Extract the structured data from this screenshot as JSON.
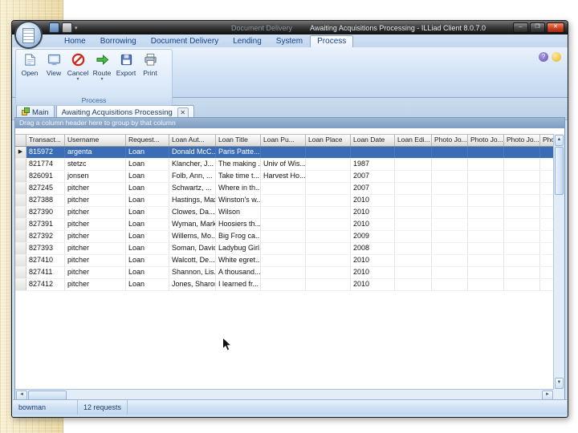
{
  "window": {
    "title_prefix": "Document Delivery",
    "title": "Awaiting Acquisitions Processing - ILLiad Client 8.0.7.0",
    "controls": {
      "minimize": "–",
      "maximize": "❐",
      "close": "✕"
    }
  },
  "quick_access": {
    "dropdown_glyph": "▾"
  },
  "ribbon": {
    "help_glyph": "?",
    "tabs": [
      {
        "label": "Home"
      },
      {
        "label": "Borrowing"
      },
      {
        "label": "Document Delivery"
      },
      {
        "label": "Lending"
      },
      {
        "label": "System"
      },
      {
        "label": "Process",
        "active": true
      }
    ],
    "group": {
      "label": "Process",
      "buttons": [
        {
          "label": "Open",
          "icon": "open-icon"
        },
        {
          "label": "View",
          "icon": "view-icon"
        },
        {
          "label": "Cancel",
          "icon": "cancel-icon",
          "menu": true
        },
        {
          "label": "Route",
          "icon": "route-icon",
          "menu": true
        },
        {
          "label": "Export",
          "icon": "export-icon"
        },
        {
          "label": "Print",
          "icon": "print-icon"
        }
      ]
    }
  },
  "doc_tabs": [
    {
      "label": "Main",
      "icon": "main-tab-icon"
    },
    {
      "label": "Awaiting Acquisitions Processing",
      "active": true,
      "closable": true,
      "close_glyph": "✕"
    }
  ],
  "grid": {
    "group_hint": "Drag a column header here to group by that column",
    "columns": [
      "Transact...",
      "Username",
      "Request...",
      "Loan Aut...",
      "Loan Title",
      "Loan Pu...",
      "Loan Place",
      "Loan Date",
      "Loan Edi...",
      "Photo Jo...",
      "Photo Jo...",
      "Photo Jo...",
      "Photo Jo..."
    ],
    "rows": [
      {
        "selected": true,
        "cells": [
          "815972",
          "argenta",
          "Loan",
          "Donald McC...",
          "Paris Patte...",
          "",
          "",
          "",
          "",
          "",
          "",
          "",
          ""
        ]
      },
      {
        "selected": false,
        "cells": [
          "821774",
          "stetzc",
          "Loan",
          "Klancher, J...",
          "The making ...",
          "Univ of Wis...",
          "",
          "1987",
          "",
          "",
          "",
          "",
          ""
        ]
      },
      {
        "selected": false,
        "cells": [
          "826091",
          "jonsen",
          "Loan",
          "Folb, Ann, ...",
          "Take time t...",
          "Harvest Ho...",
          "",
          "2007",
          "",
          "",
          "",
          "",
          ""
        ]
      },
      {
        "selected": false,
        "cells": [
          "827245",
          "pitcher",
          "Loan",
          "Schwartz, ...",
          "Where in th...",
          "",
          "",
          "2007",
          "",
          "",
          "",
          "",
          ""
        ]
      },
      {
        "selected": false,
        "cells": [
          "827388",
          "pitcher",
          "Loan",
          "Hastings, Max",
          "Winston's w...",
          "",
          "",
          "2010",
          "",
          "",
          "",
          "",
          ""
        ]
      },
      {
        "selected": false,
        "cells": [
          "827390",
          "pitcher",
          "Loan",
          "Clowes, Da...",
          "Wilson",
          "",
          "",
          "2010",
          "",
          "",
          "",
          "",
          ""
        ]
      },
      {
        "selected": false,
        "cells": [
          "827391",
          "pitcher",
          "Loan",
          "Wyman, Mark",
          "Hoosiers th...",
          "",
          "",
          "2010",
          "",
          "",
          "",
          "",
          ""
        ]
      },
      {
        "selected": false,
        "cells": [
          "827392",
          "pitcher",
          "Loan",
          "Willems, Mo...",
          "Big Frog ca...",
          "",
          "",
          "2009",
          "",
          "",
          "",
          "",
          ""
        ]
      },
      {
        "selected": false,
        "cells": [
          "827393",
          "pitcher",
          "Loan",
          "Soman, David",
          "Ladybug Girl...",
          "",
          "",
          "2008",
          "",
          "",
          "",
          "",
          ""
        ]
      },
      {
        "selected": false,
        "cells": [
          "827410",
          "pitcher",
          "Loan",
          "Walcott, De...",
          "White egret...",
          "",
          "",
          "2010",
          "",
          "",
          "",
          "",
          ""
        ]
      },
      {
        "selected": false,
        "cells": [
          "827411",
          "pitcher",
          "Loan",
          "Shannon, Lis...",
          "A thousand...",
          "",
          "",
          "2010",
          "",
          "",
          "",
          "",
          ""
        ]
      },
      {
        "selected": false,
        "cells": [
          "827412",
          "pitcher",
          "Loan",
          "Jones, Sharon",
          "I learned fr...",
          "",
          "",
          "2010",
          "",
          "",
          "",
          "",
          ""
        ]
      }
    ]
  },
  "status": {
    "left": "bowman",
    "right": "12 requests"
  },
  "scroll_glyphs": {
    "up": "▲",
    "down": "▼",
    "left": "◄",
    "right": "►"
  }
}
